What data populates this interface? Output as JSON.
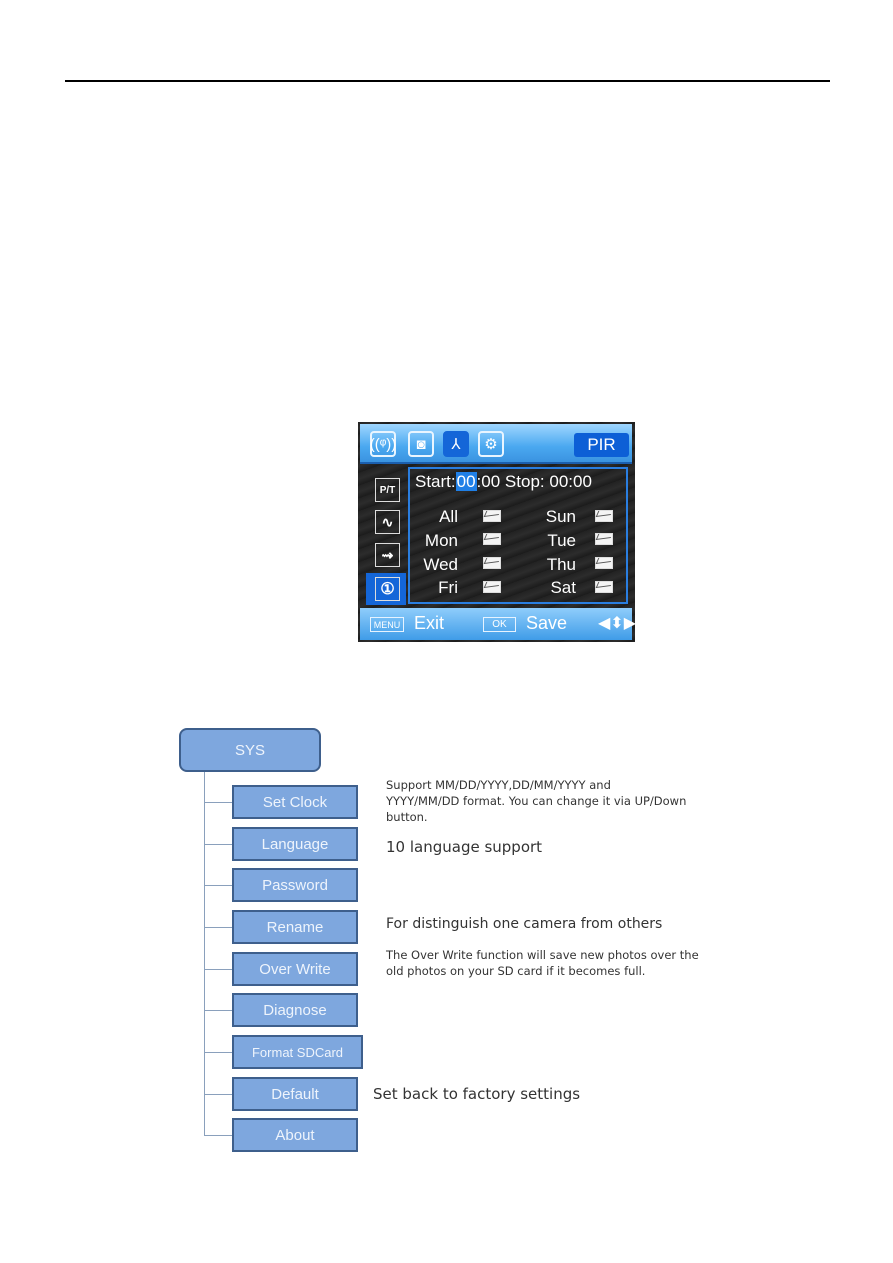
{
  "document": {
    "header_rule": true
  },
  "camera_screen": {
    "top_tabs": [
      {
        "icon": "wireless-icon",
        "glyph": "((ᵠ))",
        "active": false
      },
      {
        "icon": "camera-icon",
        "glyph": "◙",
        "active": false
      },
      {
        "icon": "antenna-tripod-icon",
        "glyph": "⅄",
        "active": true
      },
      {
        "icon": "gear-icon",
        "glyph": "⚙",
        "active": false
      }
    ],
    "mode_label": "PIR",
    "side_items": [
      {
        "icon": "pir-timer-icon",
        "label": "P/T",
        "active": false
      },
      {
        "icon": "pulse-icon",
        "label": "∿",
        "active": false
      },
      {
        "icon": "motion-arrows-icon",
        "label": "⇝",
        "active": false
      },
      {
        "icon": "timer-schedule-icon",
        "label": "①",
        "active": true
      }
    ],
    "start_label": "Start:",
    "start_hour": "00",
    "start_minute": ":00",
    "stop_label": "Stop:",
    "stop_hour": "00",
    "stop_minute": ":00",
    "days": [
      {
        "label": "All",
        "checked": true
      },
      {
        "label": "Sun",
        "checked": true
      },
      {
        "label": "Mon",
        "checked": true
      },
      {
        "label": "Tue",
        "checked": true
      },
      {
        "label": "Wed",
        "checked": true
      },
      {
        "label": "Thu",
        "checked": true
      },
      {
        "label": "Fri",
        "checked": true
      },
      {
        "label": "Sat",
        "checked": true
      }
    ],
    "bottom": {
      "menu_key": "MENU",
      "exit_label": "Exit",
      "ok_key": "OK",
      "save_label": "Save",
      "nav_glyph": "◀⬍▶"
    }
  },
  "tree": {
    "root": "SYS",
    "children": [
      {
        "label": "Set Clock",
        "desc": "Support MM/DD/YYYY,DD/MM/YYYY and YYYY/MM/DD format. You can change it via UP/Down button."
      },
      {
        "label": "Language",
        "desc": "10 language support"
      },
      {
        "label": "Password",
        "desc": ""
      },
      {
        "label": "Rename",
        "desc": "For distinguish one camera from others"
      },
      {
        "label": "Over Write",
        "desc": "The Over Write function will save new photos over the old photos on your SD card if it becomes full."
      },
      {
        "label": "Diagnose",
        "desc": ""
      },
      {
        "label": "Format SDCard",
        "desc": ""
      },
      {
        "label": "Default",
        "desc": "Set back to factory settings"
      },
      {
        "label": "About",
        "desc": ""
      }
    ],
    "desc_lines": {
      "set_clock_1": "Support MM/DD/YYYY,DD/MM/YYYY and",
      "set_clock_2": "YYYY/MM/DD format. You can change it via UP/Down",
      "set_clock_3": "button.",
      "over_write_1": "The Over Write function will save new photos over the",
      "over_write_2": "old photos on your SD card if it becomes full."
    }
  }
}
